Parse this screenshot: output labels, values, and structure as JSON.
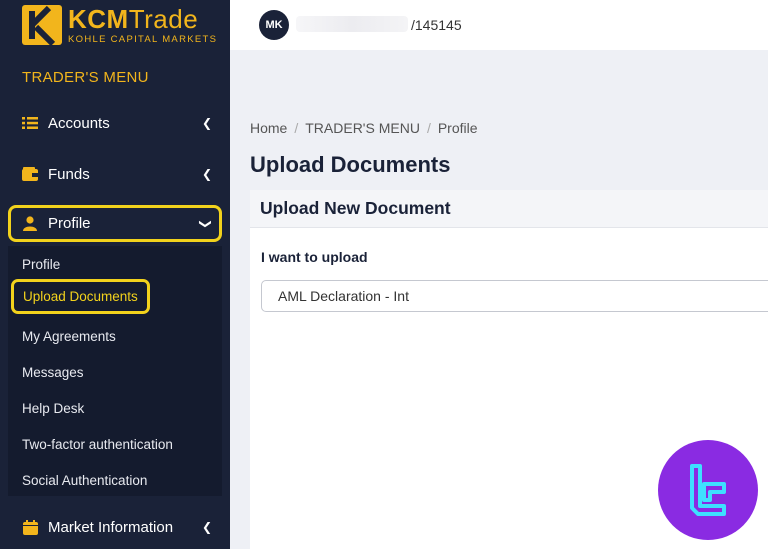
{
  "brand": {
    "name_bold": "KCM",
    "name_regular": "Trade",
    "tagline": "KOHLE CAPITAL MARKETS"
  },
  "sidebar": {
    "menu_title": "TRADER'S MENU",
    "items": [
      {
        "label": "Accounts"
      },
      {
        "label": "Funds"
      },
      {
        "label": "Profile"
      },
      {
        "label": "Market Information"
      }
    ],
    "profile_submenu": [
      {
        "label": "Profile"
      },
      {
        "label": "Upload Documents"
      },
      {
        "label": "My Agreements"
      },
      {
        "label": "Messages"
      },
      {
        "label": "Help Desk"
      },
      {
        "label": "Two-factor authentication"
      },
      {
        "label": "Social Authentication"
      }
    ]
  },
  "topbar": {
    "avatar_initials": "MK",
    "account_id": "/145145"
  },
  "breadcrumb": {
    "home": "Home",
    "section": "TRADER'S MENU",
    "current": "Profile"
  },
  "page": {
    "title": "Upload Documents"
  },
  "card": {
    "header": "Upload New Document",
    "field_label": "I want to upload",
    "selected_value": "AML Declaration - Int"
  },
  "colors": {
    "sidebar_bg": "#1a2238",
    "accent": "#f2b51c",
    "highlight": "#f2d21c",
    "watermark": "#8a2be2"
  }
}
